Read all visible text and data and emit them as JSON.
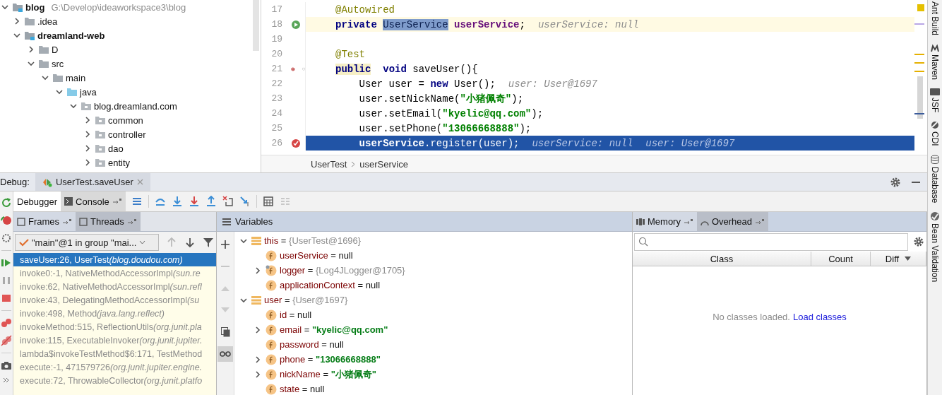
{
  "project_tree": {
    "root": {
      "label": "blog",
      "path": "G:\\Develop\\ideaworkspace3\\blog",
      "kind": "module",
      "expanded": true,
      "children": [
        {
          "label": ".idea",
          "kind": "folder",
          "expanded": false
        },
        {
          "label": "dreamland-web",
          "kind": "module",
          "expanded": true,
          "children": [
            {
              "label": "D",
              "kind": "folder",
              "expanded": false
            },
            {
              "label": "src",
              "kind": "folder",
              "expanded": true,
              "children": [
                {
                  "label": "main",
                  "kind": "folder",
                  "expanded": true,
                  "children": [
                    {
                      "label": "java",
                      "kind": "source",
                      "expanded": true,
                      "children": [
                        {
                          "label": "blog.dreamland.com",
                          "kind": "package",
                          "expanded": true,
                          "children": [
                            {
                              "label": "common",
                              "kind": "package",
                              "expanded": false
                            },
                            {
                              "label": "controller",
                              "kind": "package",
                              "expanded": false
                            },
                            {
                              "label": "dao",
                              "kind": "package",
                              "expanded": false
                            },
                            {
                              "label": "entity",
                              "kind": "package",
                              "expanded": false
                            }
                          ]
                        }
                      ]
                    }
                  ]
                }
              ]
            }
          ]
        }
      ]
    }
  },
  "editor": {
    "lines": [
      {
        "number": "17",
        "tokens": [
          {
            "text": "@Autowired",
            "kind": "annotation"
          }
        ]
      },
      {
        "number": "18",
        "gutter_icon": {
          "kind": "run"
        },
        "caret_line": true,
        "tokens": [
          {
            "text": "private ",
            "kind": "keyword"
          },
          {
            "text": "UserService",
            "kind": "usage"
          },
          {
            "text": " userService",
            "kind": "field"
          },
          {
            "text": ";",
            "kind": "plain"
          }
        ],
        "hints": [
          "userService: null"
        ]
      },
      {
        "number": "19"
      },
      {
        "number": "20",
        "tokens": [
          {
            "text": "@Test",
            "kind": "annotation"
          }
        ]
      },
      {
        "number": "21",
        "gutter_icon": {
          "kind": "breakpoint"
        },
        "fold": true,
        "tokens": [
          {
            "text": "public",
            "kind": "keyword",
            "marked": true
          },
          {
            "text": "  void",
            "kind": "keyword"
          },
          {
            "text": " saveUser(){",
            "kind": "plain"
          }
        ]
      },
      {
        "number": "22",
        "tokens": [
          {
            "text": "    User user = ",
            "kind": "plain"
          },
          {
            "text": "new",
            "kind": "keyword"
          },
          {
            "text": " User();",
            "kind": "plain"
          }
        ],
        "hints": [
          "user: User@1697"
        ]
      },
      {
        "number": "23",
        "tokens": [
          {
            "text": "    user.setNickName(",
            "kind": "plain"
          },
          {
            "text": "\"小猪佩奇\"",
            "kind": "string"
          },
          {
            "text": ");",
            "kind": "plain"
          }
        ]
      },
      {
        "number": "24",
        "tokens": [
          {
            "text": "    user.setEmail(",
            "kind": "plain"
          },
          {
            "text": "\"kyelic@qq.com\"",
            "kind": "string"
          },
          {
            "text": ");",
            "kind": "plain"
          }
        ]
      },
      {
        "number": "25",
        "tokens": [
          {
            "text": "    user.setPhone(",
            "kind": "plain"
          },
          {
            "text": "\"13066668888\"",
            "kind": "string"
          },
          {
            "text": ");",
            "kind": "plain"
          }
        ]
      },
      {
        "number": "26",
        "gutter_icon": {
          "kind": "hit"
        },
        "execution_point": true,
        "tokens": [
          {
            "text": "    userService",
            "kind": "field"
          },
          {
            "text": ".register(user);",
            "kind": "plain"
          }
        ],
        "hints": [
          "userService: null",
          "user: User@1697"
        ]
      }
    ],
    "breadcrumbs": [
      "UserTest",
      "userService"
    ]
  },
  "right_toolbar": [
    {
      "label": "Ant Build",
      "kind": "ant"
    },
    {
      "label": "Maven",
      "kind": "maven"
    },
    {
      "label": "JSF",
      "kind": "jsf"
    },
    {
      "label": "CDI",
      "kind": "cdi"
    },
    {
      "label": "Database",
      "kind": "database"
    },
    {
      "label": "Bean Validation",
      "kind": "bean"
    }
  ],
  "debug": {
    "label": "Debug:",
    "session_tab": {
      "label": "UserTest.saveUser",
      "selected": true
    },
    "tabs": [
      {
        "label": "Debugger",
        "selected": true
      },
      {
        "label": "Console",
        "selected": false
      }
    ],
    "frames_pane": {
      "tabs": [
        {
          "label": "Frames",
          "selected": true
        },
        {
          "label": "Threads",
          "selected": false
        }
      ],
      "thread": "\"main\"@1 in group \"mai...",
      "frames": [
        {
          "method": "saveUser:26, UserTest",
          "package": "(blog.doudou.com)",
          "selected": true,
          "library": false
        },
        {
          "method": "invoke0:-1, NativeMethodAccessorImpl",
          "package": "(sun.re",
          "selected": false,
          "library": true
        },
        {
          "method": "invoke:62, NativeMethodAccessorImpl",
          "package": "(sun.refl",
          "selected": false,
          "library": true
        },
        {
          "method": "invoke:43, DelegatingMethodAccessorImpl",
          "package": "(su",
          "selected": false,
          "library": true
        },
        {
          "method": "invoke:498, Method",
          "package": "(java.lang.reflect)",
          "selected": false,
          "library": true
        },
        {
          "method": "invokeMethod:515, ReflectionUtils",
          "package": "(org.junit.pla",
          "selected": false,
          "library": true
        },
        {
          "method": "invoke:115, ExecutableInvoker",
          "package": "(org.junit.jupiter.",
          "selected": false,
          "library": true
        },
        {
          "method": "lambda$invokeTestMethod$6:171, TestMethod",
          "selected": false,
          "library": true
        },
        {
          "method": "execute:-1, 471579726",
          "package": "(org.junit.jupiter.engine.",
          "selected": false,
          "library": true
        },
        {
          "method": "execute:72, ThrowableCollector",
          "package": "(org.junit.platfo",
          "selected": false,
          "library": true
        }
      ]
    },
    "variables_pane": {
      "title": "Variables",
      "variables": [
        {
          "name": "this",
          "separator": "=",
          "value": {
            "text": "{UserTest@1696}",
            "kind": "object"
          },
          "kind": "local",
          "expanded": true,
          "children": [
            {
              "name": "userService",
              "separator": "=",
              "value": {
                "text": "null",
                "kind": "null"
              },
              "kind": "field"
            },
            {
              "name": "logger",
              "separator": "=",
              "value": {
                "text": "{Log4JLogger@1705}",
                "kind": "object"
              },
              "kind": "static",
              "expanded": false
            },
            {
              "name": "applicationContext",
              "separator": "=",
              "value": {
                "text": "null",
                "kind": "null"
              },
              "kind": "field"
            }
          ]
        },
        {
          "name": "user",
          "separator": "=",
          "value": {
            "text": "{User@1697}",
            "kind": "object"
          },
          "kind": "local",
          "expanded": true,
          "children": [
            {
              "name": "id",
              "separator": "=",
              "value": {
                "text": "null",
                "kind": "null"
              },
              "kind": "field"
            },
            {
              "name": "email",
              "separator": "=",
              "value": {
                "text": "\"kyelic@qq.com\"",
                "kind": "string"
              },
              "kind": "field",
              "expanded": false
            },
            {
              "name": "password",
              "separator": "=",
              "value": {
                "text": "null",
                "kind": "null"
              },
              "kind": "field"
            },
            {
              "name": "phone",
              "separator": "=",
              "value": {
                "text": "\"13066668888\"",
                "kind": "string"
              },
              "kind": "field",
              "expanded": false
            },
            {
              "name": "nickName",
              "separator": "=",
              "value": {
                "text": "\"小猪佩奇\"",
                "kind": "string"
              },
              "kind": "field",
              "expanded": false
            },
            {
              "name": "state",
              "separator": "=",
              "value": {
                "text": "null",
                "kind": "null"
              },
              "kind": "field"
            }
          ]
        }
      ]
    },
    "memory_pane": {
      "tabs": [
        {
          "label": "Memory",
          "selected": true
        },
        {
          "label": "Overhead",
          "selected": false
        }
      ],
      "columns": [
        "Class",
        "Count",
        "Diff"
      ],
      "empty_text": "No classes loaded.",
      "link": "Load classes"
    }
  }
}
